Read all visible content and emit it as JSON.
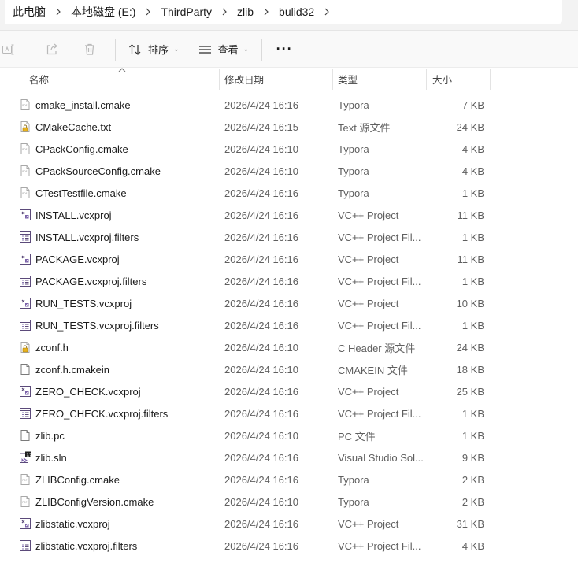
{
  "breadcrumb": [
    "此电脑",
    "本地磁盘 (E:)",
    "ThirdParty",
    "zlib",
    "bulid32"
  ],
  "toolbar": {
    "sort_label": "排序",
    "view_label": "查看",
    "more_label": "···"
  },
  "columns": {
    "name": "名称",
    "date": "修改日期",
    "type": "类型",
    "size": "大小"
  },
  "files": [
    {
      "name": "cmake_install.cmake",
      "date": "2026/4/24 16:16",
      "type": "Typora",
      "size": "7 KB",
      "icon": "typora-file-icon"
    },
    {
      "name": "CMakeCache.txt",
      "date": "2026/4/24 16:15",
      "type": "Text 源文件",
      "size": "24 KB",
      "icon": "locked-text-file-icon"
    },
    {
      "name": "CPackConfig.cmake",
      "date": "2026/4/24 16:10",
      "type": "Typora",
      "size": "4 KB",
      "icon": "typora-file-icon"
    },
    {
      "name": "CPackSourceConfig.cmake",
      "date": "2026/4/24 16:10",
      "type": "Typora",
      "size": "4 KB",
      "icon": "typora-file-icon"
    },
    {
      "name": "CTestTestfile.cmake",
      "date": "2026/4/24 16:16",
      "type": "Typora",
      "size": "1 KB",
      "icon": "typora-file-icon"
    },
    {
      "name": "INSTALL.vcxproj",
      "date": "2026/4/24 16:16",
      "type": "VC++ Project",
      "size": "11 KB",
      "icon": "vcxproj-file-icon"
    },
    {
      "name": "INSTALL.vcxproj.filters",
      "date": "2026/4/24 16:16",
      "type": "VC++ Project Fil...",
      "size": "1 KB",
      "icon": "filters-file-icon"
    },
    {
      "name": "PACKAGE.vcxproj",
      "date": "2026/4/24 16:16",
      "type": "VC++ Project",
      "size": "11 KB",
      "icon": "vcxproj-file-icon"
    },
    {
      "name": "PACKAGE.vcxproj.filters",
      "date": "2026/4/24 16:16",
      "type": "VC++ Project Fil...",
      "size": "1 KB",
      "icon": "filters-file-icon"
    },
    {
      "name": "RUN_TESTS.vcxproj",
      "date": "2026/4/24 16:16",
      "type": "VC++ Project",
      "size": "10 KB",
      "icon": "vcxproj-file-icon"
    },
    {
      "name": "RUN_TESTS.vcxproj.filters",
      "date": "2026/4/24 16:16",
      "type": "VC++ Project Fil...",
      "size": "1 KB",
      "icon": "filters-file-icon"
    },
    {
      "name": "zconf.h",
      "date": "2026/4/24 16:10",
      "type": "C Header 源文件",
      "size": "24 KB",
      "icon": "locked-header-file-icon"
    },
    {
      "name": "zconf.h.cmakein",
      "date": "2026/4/24 16:10",
      "type": "CMAKEIN 文件",
      "size": "18 KB",
      "icon": "blank-file-icon"
    },
    {
      "name": "ZERO_CHECK.vcxproj",
      "date": "2026/4/24 16:16",
      "type": "VC++ Project",
      "size": "25 KB",
      "icon": "vcxproj-file-icon"
    },
    {
      "name": "ZERO_CHECK.vcxproj.filters",
      "date": "2026/4/24 16:16",
      "type": "VC++ Project Fil...",
      "size": "1 KB",
      "icon": "filters-file-icon"
    },
    {
      "name": "zlib.pc",
      "date": "2026/4/24 16:10",
      "type": "PC 文件",
      "size": "1 KB",
      "icon": "blank-file-icon"
    },
    {
      "name": "zlib.sln",
      "date": "2026/4/24 16:16",
      "type": "Visual Studio Sol...",
      "size": "9 KB",
      "icon": "sln-file-icon"
    },
    {
      "name": "ZLIBConfig.cmake",
      "date": "2026/4/24 16:16",
      "type": "Typora",
      "size": "2 KB",
      "icon": "typora-file-icon"
    },
    {
      "name": "ZLIBConfigVersion.cmake",
      "date": "2026/4/24 16:10",
      "type": "Typora",
      "size": "2 KB",
      "icon": "typora-file-icon"
    },
    {
      "name": "zlibstatic.vcxproj",
      "date": "2026/4/24 16:16",
      "type": "VC++ Project",
      "size": "31 KB",
      "icon": "vcxproj-file-icon"
    },
    {
      "name": "zlibstatic.vcxproj.filters",
      "date": "2026/4/24 16:16",
      "type": "VC++ Project Fil...",
      "size": "4 KB",
      "icon": "filters-file-icon"
    }
  ]
}
